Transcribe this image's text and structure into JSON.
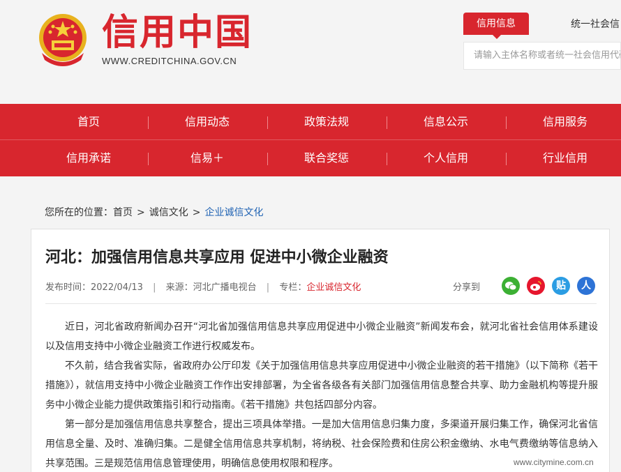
{
  "header": {
    "site_name": "信用中国",
    "site_url": "WWW.CREDITCHINA.GOV.CN",
    "tab_credit_info": "信用信息",
    "tab_uscc": "统一社会信",
    "search_placeholder": "请输入主体名称或者统一社会信用代码"
  },
  "nav": {
    "row1": [
      "首页",
      "信用动态",
      "政策法规",
      "信息公示",
      "信用服务"
    ],
    "row2": [
      "信用承诺",
      "信易＋",
      "联合奖惩",
      "个人信用",
      "行业信用"
    ]
  },
  "breadcrumb": {
    "prefix": "您所在的位置：",
    "home": "首页",
    "level2": "诚信文化",
    "current": "企业诚信文化",
    "separator": ">"
  },
  "article": {
    "title": "河北：加强信用信息共享应用 促进中小微企业融资",
    "publish_label": "发布时间：",
    "publish_date": "2022/04/13",
    "source_label": "来源：",
    "source": "河北广播电视台",
    "column_label": "专栏：",
    "column": "企业诚信文化",
    "share_label": "分享到",
    "paragraphs": [
      "近日，河北省政府新闻办召开“河北省加强信用信息共享应用促进中小微企业融资”新闻发布会，就河北省社会信用体系建设以及信用支持中小微企业融资工作进行权威发布。",
      "不久前，结合我省实际，省政府办公厅印发《关于加强信用信息共享应用促进中小微企业融资的若干措施》（以下简称《若干措施》），就信用支持中小微企业融资工作作出安排部署，为全省各级各有关部门加强信用信息整合共享、助力金融机构等提升服务中小微企业能力提供政策指引和行动指南。《若干措施》共包括四部分内容。",
      "第一部分是加强信用信息共享整合，提出三项具体举措。一是加大信用信息归集力度，多渠道开展归集工作，确保河北省信用信息全量、及时、准确归集。二是健全信用信息共享机制，将纳税、社会保险费和住房公积金缴纳、水电气费缴纳等信息纳入共享范围。三是规范信用信息管理使用，明确信息使用权限和程序。"
    ]
  },
  "share_icons": [
    {
      "name": "wechat-icon",
      "glyph": "◉",
      "color": "#3cb034"
    },
    {
      "name": "weibo-icon",
      "glyph": "◎",
      "color": "#e6162d"
    },
    {
      "name": "tieba-icon",
      "glyph": "贴",
      "color": "#2b9de3"
    },
    {
      "name": "renren-icon",
      "glyph": "人",
      "color": "#2d73d6"
    }
  ],
  "watermark": "www.citymine.com.cn",
  "colors": {
    "brand_red": "#d8262e",
    "link_blue": "#1f62b3"
  }
}
